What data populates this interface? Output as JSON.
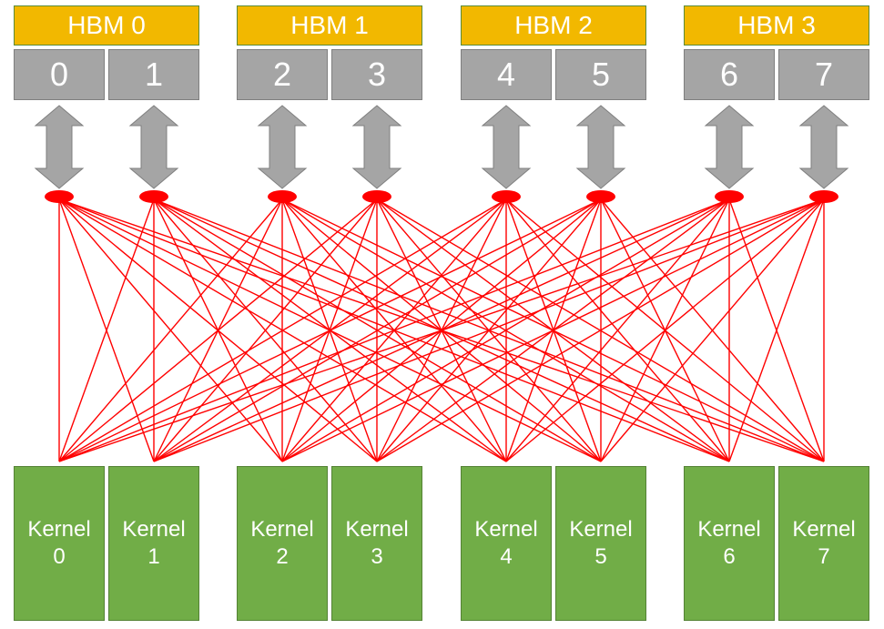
{
  "layout": {
    "groupLefts": [
      15,
      260,
      506,
      751
    ],
    "groupWidth": 204,
    "boxWidth": 100,
    "gap": 4,
    "hbmTop": 6,
    "portTop": 54,
    "kernelTop": 512,
    "arrowTopY": 116,
    "arrowBottomY": 207,
    "nodeY": 213,
    "crossbarBottomY": 507
  },
  "hbm": [
    {
      "label": "HBM 0"
    },
    {
      "label": "HBM 1"
    },
    {
      "label": "HBM 2"
    },
    {
      "label": "HBM 3"
    }
  ],
  "ports": [
    {
      "label": "0"
    },
    {
      "label": "1"
    },
    {
      "label": "2"
    },
    {
      "label": "3"
    },
    {
      "label": "4"
    },
    {
      "label": "5"
    },
    {
      "label": "6"
    },
    {
      "label": "7"
    }
  ],
  "kernels": [
    {
      "label": "Kernel",
      "index": "0"
    },
    {
      "label": "Kernel",
      "index": "1"
    },
    {
      "label": "Kernel",
      "index": "2"
    },
    {
      "label": "Kernel",
      "index": "3"
    },
    {
      "label": "Kernel",
      "index": "4"
    },
    {
      "label": "Kernel",
      "index": "5"
    },
    {
      "label": "Kernel",
      "index": "6"
    },
    {
      "label": "Kernel",
      "index": "7"
    }
  ],
  "colors": {
    "hbm": "#f2b800",
    "port": "#a5a5a5",
    "kernel": "#71ad47",
    "arrow": "#a5a5a5",
    "crossbar": "#ff0000"
  }
}
